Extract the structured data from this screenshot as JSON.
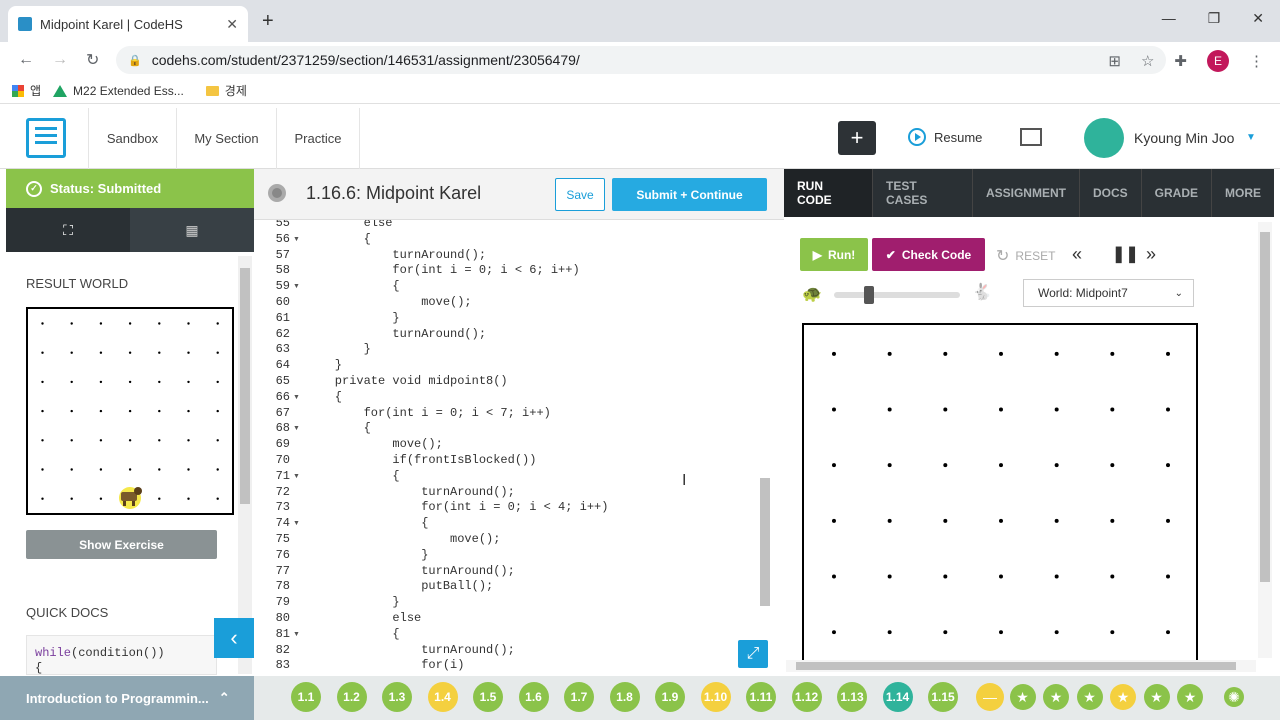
{
  "browser": {
    "tab_title": "Midpoint Karel | CodeHS",
    "url": "codehs.com/student/2371259/section/146531/assignment/23056479/",
    "bookmarks": [
      "앱",
      "M22 Extended Ess...",
      "경제"
    ],
    "profile_initial": "E"
  },
  "header": {
    "nav": [
      "Sandbox",
      "My Section",
      "Practice"
    ],
    "plus_label": "+",
    "resume_label": "Resume",
    "user_name": "Kyoung Min Joo"
  },
  "left": {
    "status": "Status: Submitted",
    "result_world_label": "RESULT WORLD",
    "show_exercise": "Show Exercise",
    "quick_docs": "QUICK DOCS",
    "qd_code_fn": "while",
    "qd_code_rest": "(condition())",
    "qd_code_line2": "{",
    "course": "Introduction to Programmin..."
  },
  "editor": {
    "title": "1.16.6: Midpoint Karel",
    "save": "Save",
    "submit": "Submit + Continue",
    "lines": [
      {
        "n": "55",
        "fold": false,
        "code": "        else"
      },
      {
        "n": "56",
        "fold": true,
        "code": "        {"
      },
      {
        "n": "57",
        "fold": false,
        "code": "            turnAround();"
      },
      {
        "n": "58",
        "fold": false,
        "code": "            for(int i = 0; i < 6; i++)"
      },
      {
        "n": "59",
        "fold": true,
        "code": "            {"
      },
      {
        "n": "60",
        "fold": false,
        "code": "                move();"
      },
      {
        "n": "61",
        "fold": false,
        "code": "            }"
      },
      {
        "n": "62",
        "fold": false,
        "code": "            turnAround();"
      },
      {
        "n": "63",
        "fold": false,
        "code": "        }"
      },
      {
        "n": "64",
        "fold": false,
        "code": "    }"
      },
      {
        "n": "65",
        "fold": false,
        "code": "    private void midpoint8()"
      },
      {
        "n": "66",
        "fold": true,
        "code": "    {"
      },
      {
        "n": "67",
        "fold": false,
        "code": "        for(int i = 0; i < 7; i++)"
      },
      {
        "n": "68",
        "fold": true,
        "code": "        {"
      },
      {
        "n": "69",
        "fold": false,
        "code": "            move();"
      },
      {
        "n": "70",
        "fold": false,
        "code": "            if(frontIsBlocked())"
      },
      {
        "n": "71",
        "fold": true,
        "code": "            {"
      },
      {
        "n": "72",
        "fold": false,
        "code": "                turnAround();"
      },
      {
        "n": "73",
        "fold": false,
        "code": "                for(int i = 0; i < 4; i++)"
      },
      {
        "n": "74",
        "fold": true,
        "code": "                {"
      },
      {
        "n": "75",
        "fold": false,
        "code": "                    move();"
      },
      {
        "n": "76",
        "fold": false,
        "code": "                }"
      },
      {
        "n": "77",
        "fold": false,
        "code": "                turnAround();"
      },
      {
        "n": "78",
        "fold": false,
        "code": "                putBall();"
      },
      {
        "n": "79",
        "fold": false,
        "code": "            }"
      },
      {
        "n": "80",
        "fold": false,
        "code": "            else"
      },
      {
        "n": "81",
        "fold": true,
        "code": "            {"
      },
      {
        "n": "82",
        "fold": false,
        "code": "                turnAround();"
      },
      {
        "n": "83",
        "fold": false,
        "code": "                for(i)"
      }
    ]
  },
  "right": {
    "tabs": [
      "RUN CODE",
      "TEST CASES",
      "ASSIGNMENT",
      "DOCS",
      "GRADE",
      "MORE"
    ],
    "active_tab": "RUN CODE",
    "run": "Run!",
    "check": "Check Code",
    "reset": "RESET",
    "world_select": "World: Midpoint7"
  },
  "units": [
    {
      "label": "1.1",
      "state": "done"
    },
    {
      "label": "1.2",
      "state": "done"
    },
    {
      "label": "1.3",
      "state": "done"
    },
    {
      "label": "1.4",
      "state": "partial"
    },
    {
      "label": "1.5",
      "state": "done"
    },
    {
      "label": "1.6",
      "state": "done"
    },
    {
      "label": "1.7",
      "state": "done"
    },
    {
      "label": "1.8",
      "state": "done"
    },
    {
      "label": "1.9",
      "state": "done"
    },
    {
      "label": "1.10",
      "state": "partial"
    },
    {
      "label": "1.11",
      "state": "done"
    },
    {
      "label": "1.12",
      "state": "done"
    },
    {
      "label": "1.13",
      "state": "done"
    },
    {
      "label": "1.14",
      "state": "current"
    },
    {
      "label": "1.15",
      "state": "done"
    }
  ],
  "colors": {
    "accent": "#1a9ed9",
    "success": "#8bc34a",
    "check": "#a01e6e",
    "dark": "#2a3034"
  }
}
